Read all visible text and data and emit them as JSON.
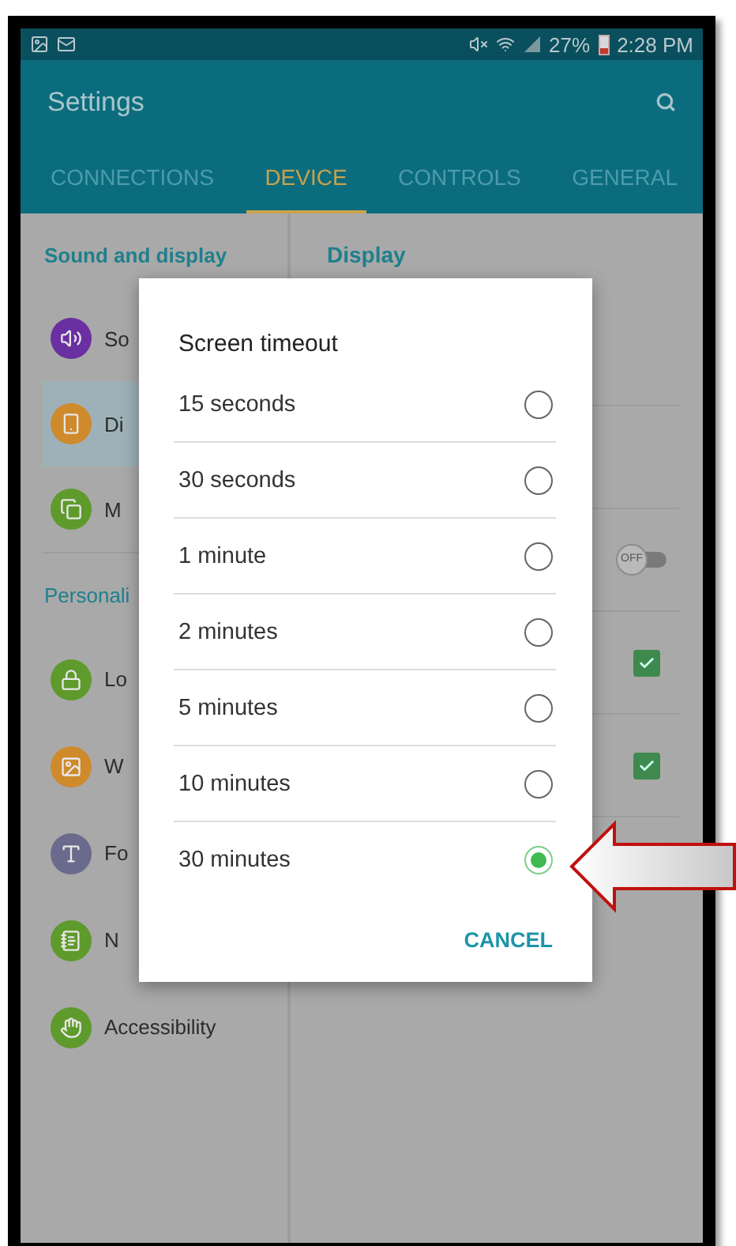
{
  "status_bar": {
    "battery": "27%",
    "time": "2:28 PM"
  },
  "app_bar": {
    "title": "Settings"
  },
  "tabs": [
    {
      "label": "CONNECTIONS",
      "selected": false
    },
    {
      "label": "DEVICE",
      "selected": true
    },
    {
      "label": "CONTROLS",
      "selected": false
    },
    {
      "label": "GENERAL",
      "selected": false
    }
  ],
  "sidebar": {
    "sections": [
      {
        "header": "Sound and display",
        "items": [
          {
            "label": "So",
            "kind": "sound",
            "color": "#6a2fa0",
            "selected": false
          },
          {
            "label": "Di",
            "kind": "display",
            "color": "#cf8a2c",
            "selected": true
          },
          {
            "label": "M",
            "kind": "multiwindow",
            "color": "#5e9a2c",
            "selected": false
          }
        ]
      },
      {
        "header": "Personali",
        "items": [
          {
            "label": "Lo",
            "kind": "lock",
            "color": "#5e9a2c",
            "selected": false
          },
          {
            "label": "W",
            "kind": "wallpaper",
            "color": "#cf8a2c",
            "selected": false
          },
          {
            "label": "Fo",
            "kind": "font",
            "color": "#6a6a8c",
            "selected": false
          },
          {
            "label": "N",
            "kind": "notes",
            "color": "#5e9a2c",
            "selected": false
          },
          {
            "label": "Accessibility",
            "kind": "accessibility",
            "color": "#5e9a2c",
            "selected": false
          }
        ]
      }
    ]
  },
  "detail": {
    "header": "Display",
    "settings": [
      {
        "kind": "blank"
      },
      {
        "kind": "toggle",
        "label": "OFF",
        "on": false
      },
      {
        "kind": "checkbox",
        "checked": true
      },
      {
        "kind": "checkbox",
        "checked": true
      }
    ]
  },
  "dialog": {
    "title": "Screen timeout",
    "options": [
      {
        "label": "15 seconds",
        "selected": false
      },
      {
        "label": "30 seconds",
        "selected": false
      },
      {
        "label": "1 minute",
        "selected": false
      },
      {
        "label": "2 minutes",
        "selected": false
      },
      {
        "label": "5 minutes",
        "selected": false
      },
      {
        "label": "10 minutes",
        "selected": false
      },
      {
        "label": "30 minutes",
        "selected": true
      }
    ],
    "cancel": "CANCEL"
  }
}
